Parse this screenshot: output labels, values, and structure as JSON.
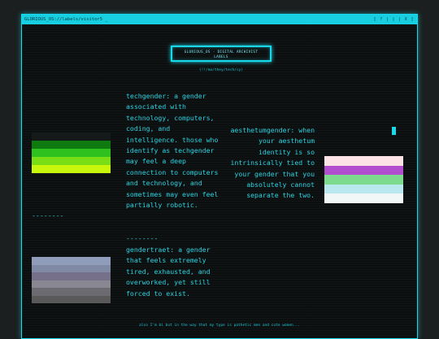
{
  "titlebar": {
    "path": "GLORIOUS_OS://labels/visitor5 _",
    "controls": "[ ? | | | X ]"
  },
  "badge": {
    "line1": "GLORIOUS_OS - DIGITAL ARCHIVIST",
    "line2": "LABELS"
  },
  "subtitle": "(!!/mo/they/tech/cy)",
  "entries": {
    "techgender": "techgender: a gender associated with technology, computers, coding, and intelligence. those who identify as techgender may feel a deep connection to computers and technology, and sometimes may even feel partially robotic.",
    "divider_mid": "--------",
    "gendertraet": "gendertraet: a gender that feels extremely tired, exhausted, and overworked, yet still forced to exist.",
    "divider_left": "--------",
    "aesthetumgender": "aesthetumgender: when your aesthetum identity is so intrinsically tied to your gender that you absolutely cannot separate the two."
  },
  "flags": {
    "techgender": [
      "#141a1a",
      "#0e7a10",
      "#2fc11d",
      "#79de15",
      "#c8f70b"
    ],
    "aesthetumgender": [
      "#fde2e6",
      "#b14fcf",
      "#7ddb8e",
      "#b9e9ee",
      "#f1f7f7"
    ],
    "gendertraet": [
      "#8f9dbb",
      "#818aa5",
      "#77708a",
      "#898791",
      "#6b6a70",
      "#595959"
    ]
  },
  "footer": "also I'm bi but in the way that my type is pathetic men and cute women..."
}
